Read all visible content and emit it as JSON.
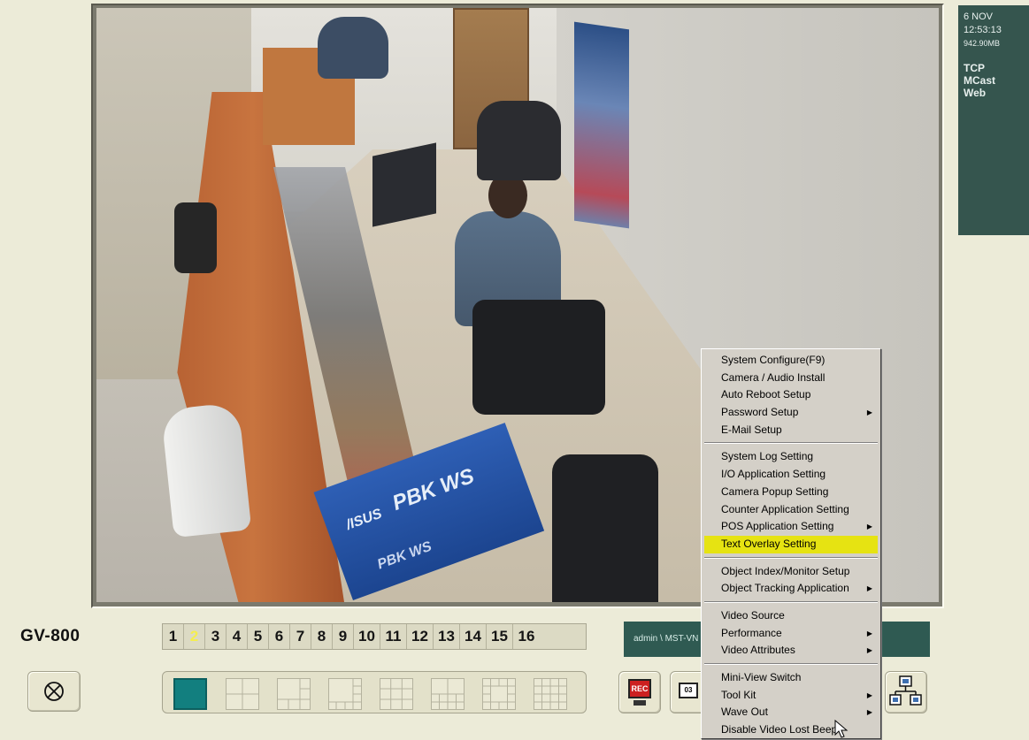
{
  "app": {
    "brand": "GV-800"
  },
  "status_panel": {
    "date": "6 NOV",
    "time": "12:53:13",
    "disk": "942.90MB",
    "protocols": [
      "TCP",
      "MCast",
      "Web"
    ]
  },
  "camera_numbers": [
    "1",
    "2",
    "3",
    "4",
    "5",
    "6",
    "7",
    "8",
    "9",
    "10",
    "11",
    "12",
    "13",
    "14",
    "15",
    "16"
  ],
  "selected_camera": "2",
  "message_box": {
    "text": "admin \\ MST-VN"
  },
  "toolbar": {
    "rec_label": "REC",
    "calendar_day": "03"
  },
  "colors": {
    "background": "#ecebd8",
    "status_panel": "#35554e",
    "menu_highlight": "#e6e312",
    "single_layout": "#127f7f"
  },
  "context_menu": {
    "group1": [
      {
        "label": "System Configure(F9)",
        "submenu": false
      },
      {
        "label": "Camera / Audio Install",
        "submenu": false
      },
      {
        "label": "Auto Reboot Setup",
        "submenu": false
      },
      {
        "label": "Password Setup",
        "submenu": true
      },
      {
        "label": "E-Mail Setup",
        "submenu": false
      }
    ],
    "group2": [
      {
        "label": "System Log Setting",
        "submenu": false
      },
      {
        "label": "I/O Application Setting",
        "submenu": false
      },
      {
        "label": "Camera Popup Setting",
        "submenu": false
      },
      {
        "label": "Counter Application Setting",
        "submenu": false
      },
      {
        "label": "POS Application Setting",
        "submenu": true
      },
      {
        "label": "Text Overlay Setting",
        "submenu": false,
        "highlighted": true
      }
    ],
    "group3": [
      {
        "label": "Object Index/Monitor Setup",
        "submenu": false
      },
      {
        "label": "Object Tracking Application",
        "submenu": true
      }
    ],
    "group4": [
      {
        "label": "Video Source",
        "submenu": false
      },
      {
        "label": "Performance",
        "submenu": true
      },
      {
        "label": "Video Attributes",
        "submenu": true
      }
    ],
    "group5": [
      {
        "label": "Mini-View Switch",
        "submenu": false
      },
      {
        "label": "Tool Kit",
        "submenu": true
      },
      {
        "label": "Wave Out",
        "submenu": true
      },
      {
        "label": "Disable Video Lost Beep",
        "submenu": false
      }
    ]
  },
  "video": {
    "box_text_main": "PBK WS",
    "box_text_brand": "/ISUS",
    "box_text_bottom": "PBK WS"
  }
}
